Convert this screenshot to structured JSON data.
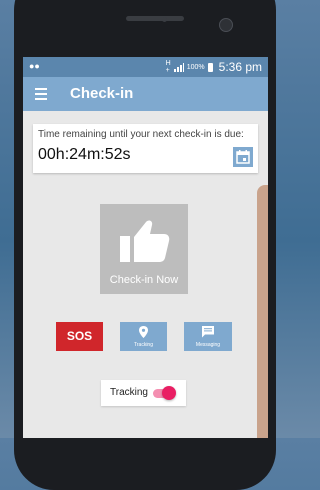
{
  "status_bar": {
    "left_icon": "dots-icon",
    "network": "H",
    "network_sub": "+",
    "battery_pct": "100%",
    "time": "5:36 pm"
  },
  "app_bar": {
    "title": "Check-in",
    "menu_icon": "hamburger-menu-icon"
  },
  "countdown": {
    "label": "Time remaining until your next check-in is due:",
    "value": "00h:24m:52s",
    "calendar_icon": "calendar-icon"
  },
  "checkin": {
    "label": "Check-in Now",
    "icon": "thumbs-up-icon"
  },
  "actions": {
    "sos_label": "SOS",
    "tracking_label": "Tracking",
    "messaging_label": "Messaging"
  },
  "tracking_toggle": {
    "label": "Tracking",
    "on": true
  },
  "colors": {
    "status_bar": "#5b86ad",
    "app_bar": "#7fa9cf",
    "sos": "#d0262b",
    "toggle_on": "#e91e63",
    "screen_bg": "#e8e8e8"
  }
}
